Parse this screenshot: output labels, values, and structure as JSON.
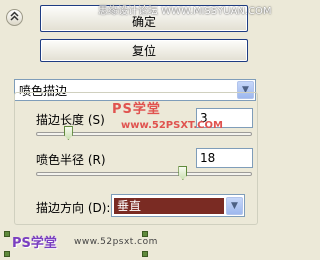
{
  "buttons": {
    "collapse_icon": "chevron-double-up",
    "ok_label": "确定",
    "reset_label": "复位"
  },
  "filter_select": {
    "value": "喷色描边"
  },
  "params": {
    "stroke_length": {
      "label": "描边长度 (S)",
      "value": "3",
      "level": 0.15
    },
    "spray_radius": {
      "label": "喷色半径 (R)",
      "value": "18",
      "level": 0.68
    },
    "stroke_direction": {
      "label": "描边方向 (D):",
      "value": "垂直"
    }
  },
  "watermarks": {
    "top": "思缘设计论坛 WWW.MISSYUAN.COM",
    "center_logo": "PS学堂",
    "center_url": "www.52PSXT.COM",
    "bottom_logo": "PS学堂",
    "bottom_url": "www.52psxt.com"
  },
  "colors": {
    "selected_bg": "#7a2b23",
    "button_border": "#1e3c82",
    "background": "#ece9d8"
  }
}
